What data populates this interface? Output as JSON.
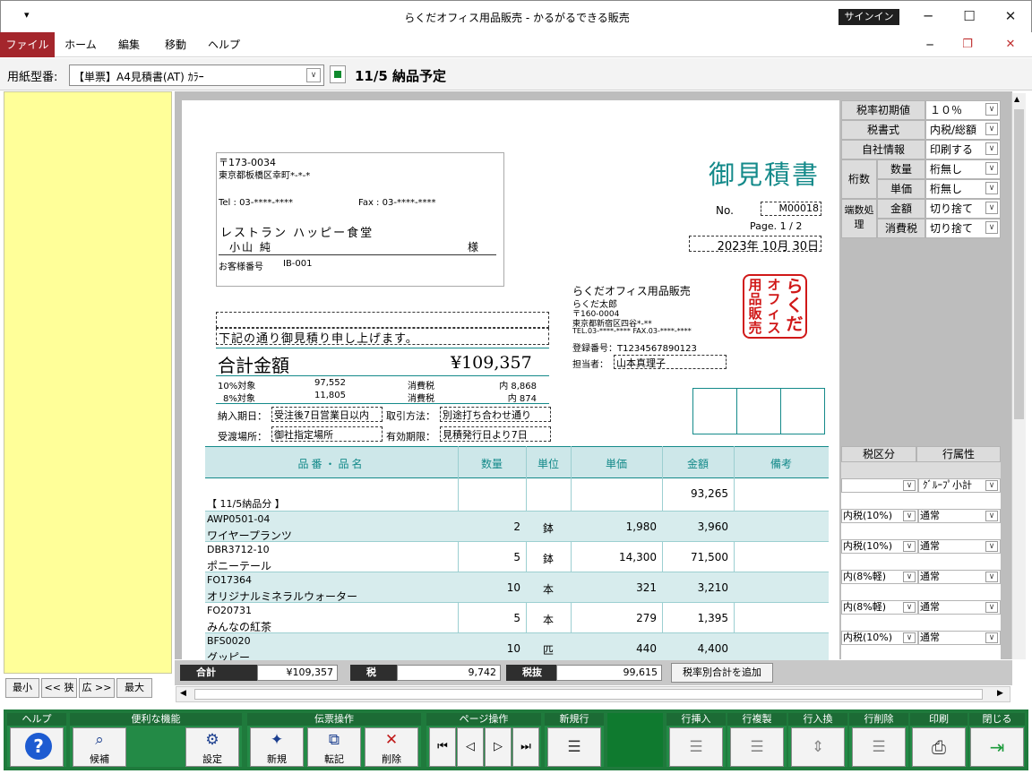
{
  "window": {
    "qat_glyph": "▾",
    "title": "らくだオフィス用品販売 - かるがるできる販売",
    "signin": "サインイン",
    "min_glyph": "─",
    "max_glyph": "☐",
    "close_glyph": "✕"
  },
  "ribbon": {
    "tabs": [
      "ファイル",
      "ホーム",
      "編集",
      "移動",
      "ヘルプ"
    ],
    "min_glyph": "─",
    "restore_glyph": "❐",
    "close_glyph": "✕"
  },
  "paper": {
    "label": "用紙型番:",
    "value": "【単票】A4見積書(AT) ｶﾗｰ",
    "dd": "∨",
    "status": "11/5 納品予定"
  },
  "customer": {
    "zip": "〒173-0034",
    "address": "東京都板橋区幸町*-*-*",
    "tel": "Tel : 03-****-****",
    "fax": "Fax : 03-****-****",
    "company": "レストラン ハッピー食堂",
    "person": "小山 純",
    "honorific": "様",
    "number_label": "お客様番号",
    "number": "IB-001"
  },
  "document": {
    "title": "御見積書",
    "no_label": "No.",
    "no": "M00018",
    "page": "Page. 1 / 2",
    "date": "2023年 10月 30日",
    "greeting": "下記の通り御見積り申し上げます。",
    "total_label": "合計金額",
    "total": "¥109,357",
    "tax10_label": "10%対象",
    "tax10_base": "97,552",
    "tax10_tax_label": "消費税",
    "tax10_tax": "内 8,868",
    "tax8_label": "8%対象",
    "tax8_base": "11,805",
    "tax8_tax_label": "消費税",
    "tax8_tax": "内 874",
    "delivery_label": "納入期日：",
    "delivery": "受注後7日営業日以内",
    "payment_label": "取引方法：",
    "payment": "別途打ち合わせ通り",
    "place_label": "受渡場所：",
    "place": "御社指定場所",
    "valid_label": "有効期限：",
    "valid": "見積発行日より7日"
  },
  "sender": {
    "company": "らくだオフィス用品販売",
    "person": "らくだ太郎",
    "zip": "〒160-0004",
    "address": "東京都新宿区四谷*-**",
    "telfax": "TEL.03-****-****  FAX.03-****-****",
    "reg": "登録番号：T1234567890123",
    "staff_label": "担当者：",
    "staff": "山本真理子",
    "seal": [
      "らくだ",
      "オフィス",
      "用品販売"
    ]
  },
  "table": {
    "headers": [
      "品番・品名",
      "数量",
      "単位",
      "単価",
      "金額",
      "備考"
    ],
    "group_label": "【 11/5納品分 】",
    "group_total": "93,265",
    "rows": [
      {
        "code": "AWP0501-04",
        "name": "ワイヤープランツ",
        "qty": "2",
        "unit": "鉢",
        "price": "1,980",
        "amount": "3,960"
      },
      {
        "code": "DBR3712-10",
        "name": "ポニーテール",
        "qty": "5",
        "unit": "鉢",
        "price": "14,300",
        "amount": "71,500"
      },
      {
        "code": "FO17364",
        "name": "オリジナルミネラルウォーター",
        "qty": "10",
        "unit": "本",
        "price": "321",
        "amount": "3,210"
      },
      {
        "code": "FO20731",
        "name": "みんなの紅茶",
        "qty": "5",
        "unit": "本",
        "price": "279",
        "amount": "1,395"
      },
      {
        "code": "BFS0020",
        "name": "グッピー",
        "qty": "10",
        "unit": "匹",
        "price": "440",
        "amount": "4,400"
      }
    ]
  },
  "settings": [
    {
      "label": "税率初期値",
      "value": "１０％"
    },
    {
      "label": "税書式",
      "value": "内税/総額"
    },
    {
      "label": "自社情報",
      "value": "印刷する"
    }
  ],
  "settings2": {
    "keta_label": "桁数",
    "hasu_label": "端数処理",
    "rows": [
      {
        "label": "数量",
        "value": "桁無し"
      },
      {
        "label": "単価",
        "value": "桁無し"
      },
      {
        "label": "金額",
        "value": "切り捨て"
      },
      {
        "label": "消費税",
        "value": "切り捨て"
      }
    ]
  },
  "row_attrs": {
    "headers": [
      "税区分",
      "行属性"
    ],
    "group_value": "ｸﾞﾙｰﾌﾟ小計",
    "rows": [
      {
        "tax": "内税(10%)",
        "attr": "通常"
      },
      {
        "tax": "内税(10%)",
        "attr": "通常"
      },
      {
        "tax": "内(8%軽)",
        "attr": "通常"
      },
      {
        "tax": "内(8%軽)",
        "attr": "通常"
      },
      {
        "tax": "内税(10%)",
        "attr": "通常"
      }
    ]
  },
  "zoom": [
    "最小",
    "<< 狭",
    "広 >>",
    "最大"
  ],
  "totals": {
    "sum_label": "合計",
    "sum": "¥109,357",
    "tax_label": "税",
    "tax": "9,742",
    "net_label": "税抜",
    "net": "99,615",
    "add_button": "税率別合計を追加"
  },
  "toolbar": {
    "help_label": "ヘルプ",
    "util_label": "便利な機能",
    "candidate": "候補",
    "setting": "設定",
    "slip_label": "伝票操作",
    "new": "新規",
    "copy": "転記",
    "delete": "削除",
    "page_label": "ページ操作",
    "newrow_label": "新規行",
    "ins_label": "行挿入",
    "dup_label": "行複製",
    "swap_label": "行入換",
    "delrow_label": "行削除",
    "print_label": "印刷",
    "close_label": "閉じる"
  }
}
